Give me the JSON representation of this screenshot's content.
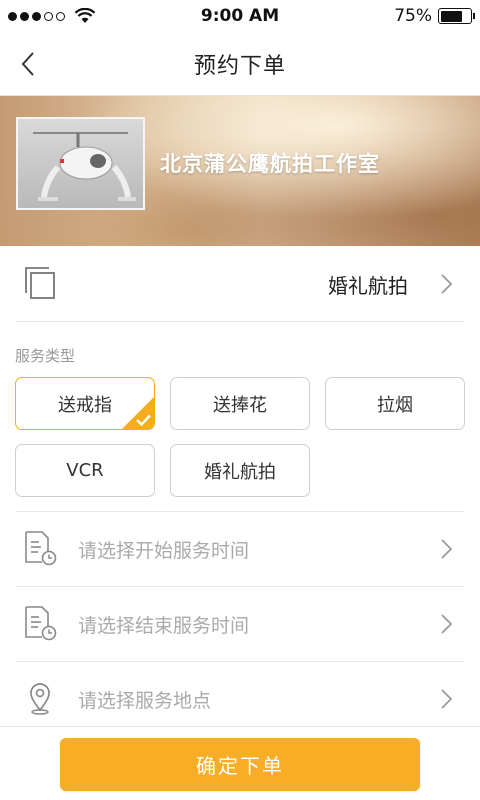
{
  "status_bar": {
    "time": "9:00 AM",
    "battery": "75%",
    "battery_level": 0.75
  },
  "nav": {
    "title": "预约下单"
  },
  "banner": {
    "studio_name": "北京蒲公鹰航拍工作室"
  },
  "category": {
    "value": "婚礼航拍"
  },
  "services": {
    "label": "服务类型",
    "options": [
      {
        "label": "送戒指",
        "selected": true
      },
      {
        "label": "送捧花",
        "selected": false
      },
      {
        "label": "拉烟",
        "selected": false
      },
      {
        "label": "VCR",
        "selected": false
      },
      {
        "label": "婚礼航拍",
        "selected": false
      }
    ]
  },
  "pickers": {
    "start_time": "请选择开始服务时间",
    "end_time": "请选择结束服务时间",
    "location": "请选择服务地点"
  },
  "footer": {
    "confirm_label": "确定下单"
  },
  "colors": {
    "accent": "#f7ad26",
    "placeholder": "#aaaaaa"
  }
}
